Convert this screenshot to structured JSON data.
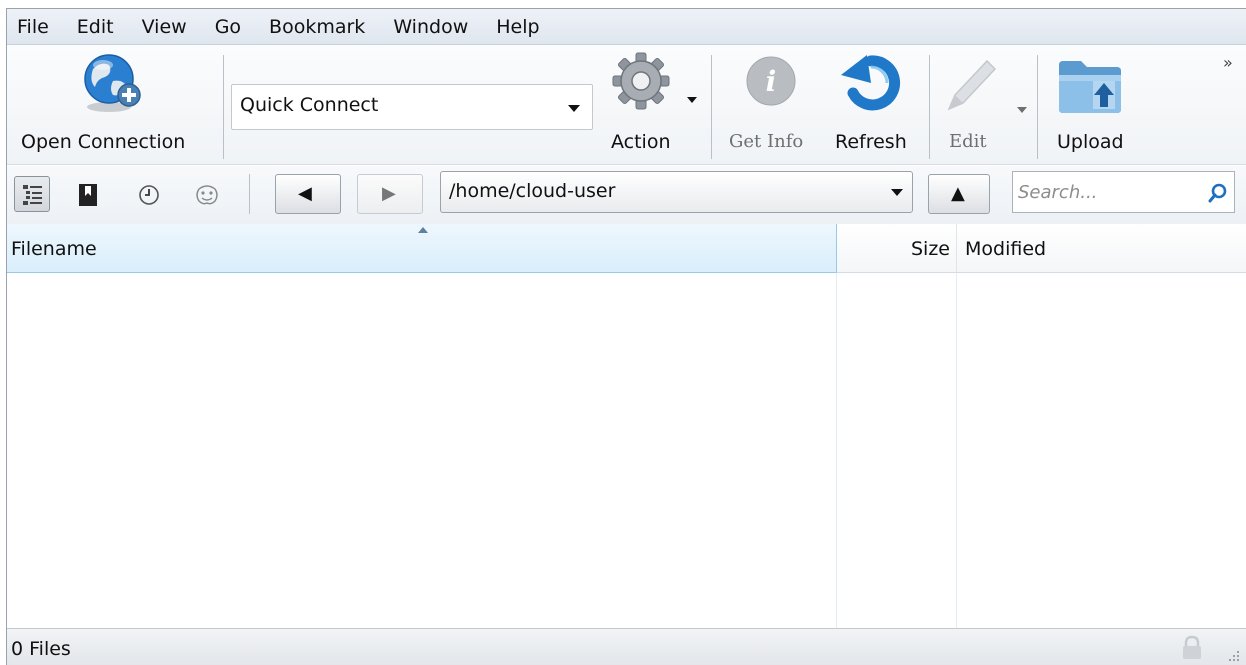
{
  "menubar": {
    "items": [
      "File",
      "Edit",
      "View",
      "Go",
      "Bookmark",
      "Window",
      "Help"
    ]
  },
  "toolbar": {
    "open_connection": {
      "label": "Open Connection",
      "icon": "globe-add-icon"
    },
    "quick_connect": {
      "value": "Quick Connect"
    },
    "action": {
      "label": "Action",
      "icon": "gear-icon"
    },
    "get_info": {
      "label": "Get Info",
      "icon": "info-icon",
      "enabled": false
    },
    "refresh": {
      "label": "Refresh",
      "icon": "refresh-icon"
    },
    "edit": {
      "label": "Edit",
      "icon": "pencil-icon",
      "enabled": false
    },
    "upload": {
      "label": "Upload",
      "icon": "upload-folder-icon"
    },
    "overflow": "»"
  },
  "navbar": {
    "view_buttons": [
      "browser-view-icon",
      "bookmarks-icon",
      "history-icon",
      "bonjour-icon"
    ],
    "back": "◀",
    "forward": "▶",
    "path": "/home/cloud-user",
    "up": "▲",
    "search_placeholder": "Search..."
  },
  "filelist": {
    "columns": [
      {
        "label": "Filename",
        "sorted": true
      },
      {
        "label": "Size"
      },
      {
        "label": "Modified"
      }
    ],
    "rows": []
  },
  "statusbar": {
    "text": "0 Files",
    "lock_icon": "lock-icon",
    "grip_icon": "resize-grip-icon"
  },
  "colors": {
    "accent_blue": "#1f78c8",
    "sorted_header": "#d9eefb",
    "menubar": "#e6ebf2"
  }
}
